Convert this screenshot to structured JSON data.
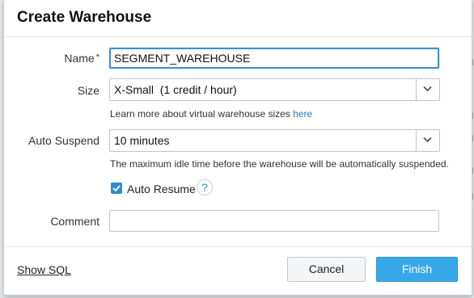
{
  "dialog": {
    "title": "Create Warehouse",
    "name": {
      "label": "Name",
      "required_mark": "*",
      "value": "SEGMENT_WAREHOUSE"
    },
    "size": {
      "label": "Size",
      "value": "X-Small  (1 credit / hour)",
      "hint_prefix": "Learn more about virtual warehouse sizes ",
      "hint_link": "here"
    },
    "auto_suspend": {
      "label": "Auto Suspend",
      "value": "10 minutes",
      "hint": "The maximum idle time before the warehouse will be automatically suspended."
    },
    "auto_resume": {
      "label": "Auto Resume",
      "checked": true,
      "help_icon": "?"
    },
    "comment": {
      "label": "Comment",
      "value": ""
    },
    "footer": {
      "show_sql": "Show SQL",
      "cancel": "Cancel",
      "finish": "Finish"
    }
  },
  "background": {
    "edge_letters": [
      "N",
      "N",
      "N",
      "N",
      "N"
    ]
  },
  "colors": {
    "accent": "#37a8e8",
    "focus_border": "#3b8fd6",
    "link": "#2a7bc0"
  }
}
